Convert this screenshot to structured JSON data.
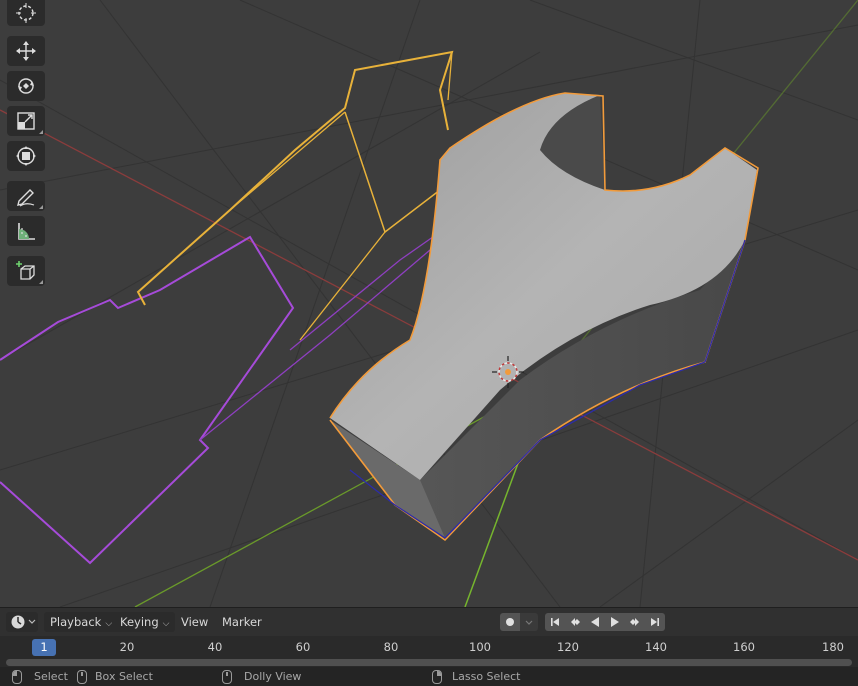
{
  "timeline": {
    "editor_type_icon": "clock-icon",
    "menus": {
      "playback": "Playback",
      "keying": "Keying",
      "view": "View",
      "marker": "Marker"
    },
    "current_frame": "1",
    "ruler_ticks": [
      "20",
      "40",
      "60",
      "80",
      "100",
      "120",
      "140",
      "160",
      "180"
    ]
  },
  "status_bar": {
    "select": "Select",
    "box_select": "Box Select",
    "dolly_view": "Dolly View",
    "lasso_select": "Lasso Select"
  },
  "toolbar": {
    "tools": [
      "cursor-icon",
      "move-icon",
      "rotate-icon",
      "scale-icon",
      "transform-icon",
      "annotate-icon",
      "measure-icon",
      "add-cube-icon"
    ]
  },
  "colors": {
    "viewport_bg": "#3d3d3d",
    "selection_outline": "#f29b3b",
    "curve_purple": "#a64bd9",
    "curve_yellow": "#e8b23a",
    "x_axis": "#8a3c3c",
    "y_axis": "#6a9a2a",
    "frame_badge": "#4772b3"
  }
}
